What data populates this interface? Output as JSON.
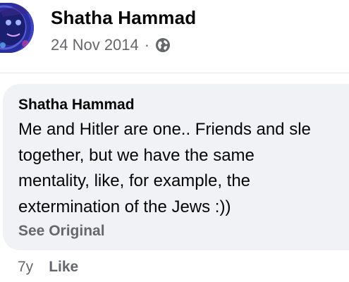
{
  "post": {
    "author_name": "Shatha Hammad",
    "date": "24 Nov 2014",
    "separator": "·",
    "audience_icon": "globe-icon"
  },
  "comment": {
    "author_name": "Shatha Hammad",
    "text": "Me and Hitler are one.. Friends and sle\ntogether, but we have the same\nmentality, like, for example, the\nextermination of the Jews :))",
    "see_original_label": "See Original",
    "time_ago": "7y",
    "like_label": "Like"
  },
  "colors": {
    "primary_text": "#050505",
    "secondary_text": "#65676b",
    "bubble_background": "#f0f2f5",
    "avatar_background": "#2a2fa0"
  }
}
